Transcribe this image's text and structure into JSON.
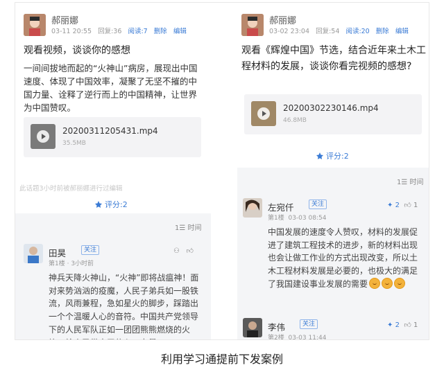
{
  "left_post": {
    "author": "郝丽娜",
    "date": "03-11 20:55",
    "replies": "回复:36",
    "reads": "阅读:7",
    "delete": "删除",
    "edit": "编辑",
    "title": "观看视频，谈谈你的感想",
    "body": "一间间拔地而起的“火神山”病房，展现出中国速度、体现了中国效率，凝聚了无坚不摧的中国力量、诠释了逆行而上的中国精神，让世界为中国赞叹。",
    "video": {
      "name": "20200311205431.mp4",
      "size": "35.5MB"
    },
    "edit_note": "此话题3小时前被郝丽娜进行过编辑",
    "rating": "评分:2",
    "sort": "时间"
  },
  "left_comment": {
    "name": "田昊",
    "follow": "关注",
    "floor": "第1楼",
    "time": "3小时前",
    "text": "神兵天降火神山，“火神”即将战瘟神！面对来势汹汹的疫魔，人民子弟兵如一股铁流，风雨兼程，急如星火的脚步，踩踏出一个个温暖人心的音符。中国共产党领导下的人民军队正如一团团熊熊燃烧的火焰，给人民带来了信心、力量"
  },
  "right_post": {
    "author": "郝丽娜",
    "date": "03-02 23:04",
    "replies": "回复:54",
    "reads": "阅读:20",
    "delete": "删除",
    "edit": "编辑",
    "title": "观看《辉煌中国》节选，结合近年来土木工程材料的发展，谈谈你看完视频的感想?",
    "video": {
      "name": "20200302230146.mp4",
      "size": "46.8MB"
    },
    "rating": "评分:2",
    "sort": "时间"
  },
  "right_comments": [
    {
      "name": "左宛仟",
      "follow": "关注",
      "floor": "第1楼",
      "time": "03-03 08:54",
      "rating": "2",
      "likes": "1",
      "text": "中国发展的速度令人赞叹，材料的发展促进了建筑工程技术的进步，新的材料出现也会让做工作业的方式出现改变，所以土木工程材料发展是必要的，也极大的满足了我国建设事业发展的需要"
    },
    {
      "name": "李伟",
      "follow": "关注",
      "floor": "第2楼",
      "time": "03-03 11:44",
      "rating": "2",
      "likes": "1"
    }
  ],
  "caption": "利用学习通提前下发案例",
  "colors": {
    "accent": "#3a7bd5",
    "band": "#f4f5f7"
  }
}
